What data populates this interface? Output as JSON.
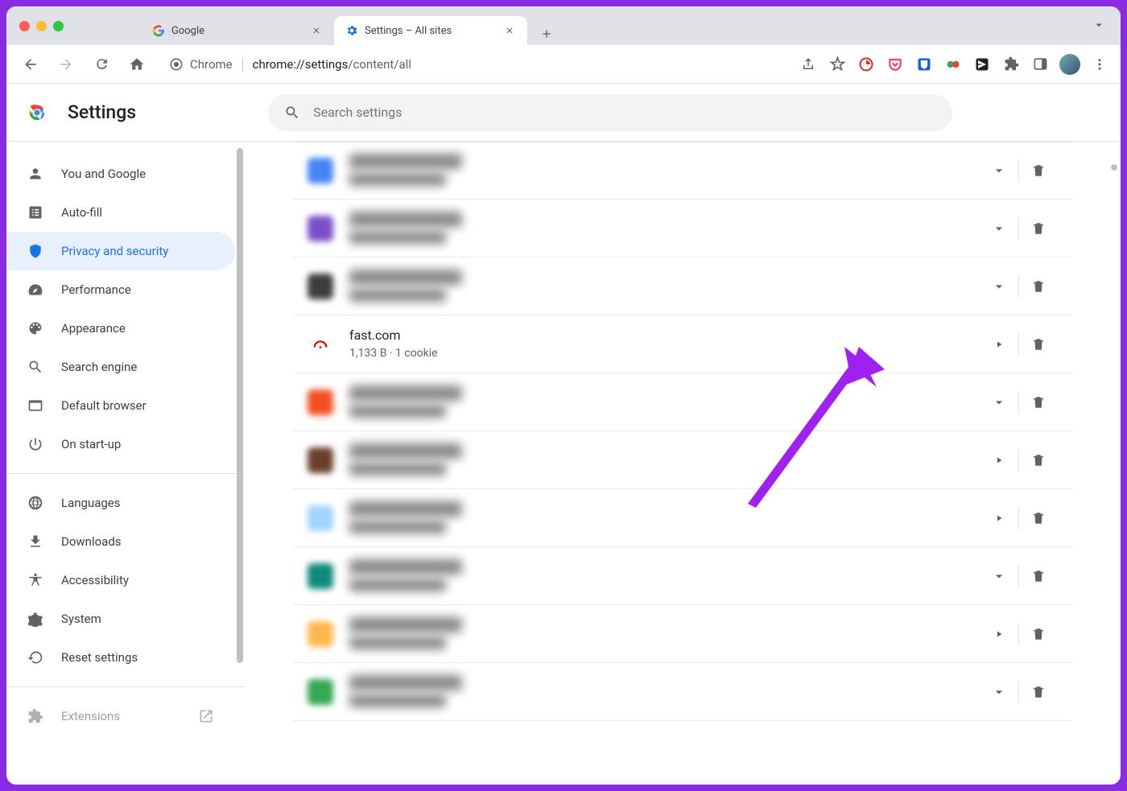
{
  "chrome": {
    "tabs": [
      {
        "title": "Google",
        "favicon": "google"
      },
      {
        "title": "Settings – All sites",
        "favicon": "settings",
        "active": true
      }
    ],
    "url_prefix": "Chrome",
    "url_dark": "chrome://settings",
    "url_rest": "/content/all"
  },
  "header": {
    "title": "Settings",
    "search_placeholder": "Search settings"
  },
  "sidebar": {
    "items": [
      {
        "id": "you",
        "label": "You and Google"
      },
      {
        "id": "autofill",
        "label": "Auto-fill"
      },
      {
        "id": "privacy",
        "label": "Privacy and security",
        "active": true
      },
      {
        "id": "performance",
        "label": "Performance"
      },
      {
        "id": "appearance",
        "label": "Appearance"
      },
      {
        "id": "search",
        "label": "Search engine"
      },
      {
        "id": "default",
        "label": "Default browser"
      },
      {
        "id": "startup",
        "label": "On start-up"
      }
    ],
    "items2": [
      {
        "id": "languages",
        "label": "Languages"
      },
      {
        "id": "downloads",
        "label": "Downloads"
      },
      {
        "id": "accessibility",
        "label": "Accessibility"
      },
      {
        "id": "system",
        "label": "System"
      },
      {
        "id": "reset",
        "label": "Reset settings"
      }
    ],
    "extensions_label": "Extensions"
  },
  "sites": [
    {
      "blurred": true,
      "icon": "ic-blue",
      "name": "example1.com",
      "meta": "123 B · 2 cookies",
      "expand": "chevron"
    },
    {
      "blurred": true,
      "icon": "ic-purple",
      "name": "siteabc.io",
      "meta": "88 B · 1 cookie",
      "expand": "chevron"
    },
    {
      "blurred": true,
      "icon": "ic-dark",
      "name": "someother.net",
      "meta": "456 B · 4 cookies",
      "expand": "chevron"
    },
    {
      "blurred": false,
      "icon": "ic-none",
      "favicon": "fast",
      "name": "fast.com",
      "meta": "1,133 B · 1 cookie",
      "expand": "arrow"
    },
    {
      "blurred": true,
      "icon": "ic-orange",
      "name": "blur5.org",
      "meta": "22 B · 1 cookie",
      "expand": "chevron"
    },
    {
      "blurred": true,
      "icon": "ic-brown",
      "name": "blur6.com",
      "meta": "67 B · 3 cookies",
      "expand": "arrow"
    },
    {
      "blurred": true,
      "icon": "ic-lblue",
      "name": "blur7.io",
      "meta": "12 B · 1 cookie",
      "expand": "arrow"
    },
    {
      "blurred": true,
      "icon": "ic-teal",
      "name": "blur8.co",
      "meta": "99 B · 2 cookies",
      "expand": "chevron"
    },
    {
      "blurred": true,
      "icon": "ic-lorange",
      "name": "blur9.dev",
      "meta": "33 B · 1 cookie",
      "expand": "arrow"
    },
    {
      "blurred": true,
      "icon": "ic-green",
      "name": "blur10.app",
      "meta": "45 B · 2 cookies",
      "expand": "chevron"
    }
  ]
}
